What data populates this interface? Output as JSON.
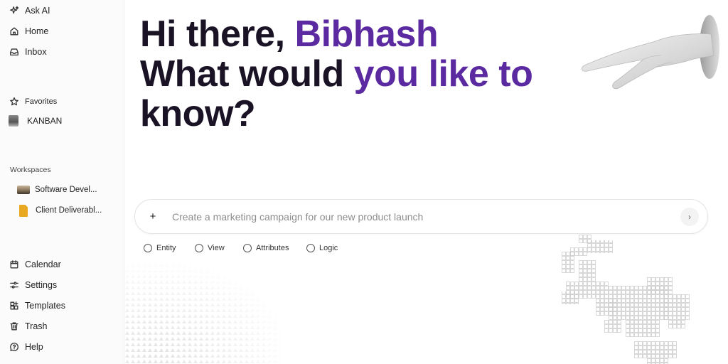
{
  "sidebar": {
    "top_items": [
      {
        "label": "Ask AI",
        "icon": "sparkle-icon"
      },
      {
        "label": "Home",
        "icon": "home-icon"
      },
      {
        "label": "Inbox",
        "icon": "inbox-icon"
      }
    ],
    "favorites": {
      "label": "Favorites",
      "items": [
        {
          "label": "KANBAN",
          "icon": "avatar-icon"
        }
      ]
    },
    "workspaces": {
      "label": "Workspaces",
      "items": [
        {
          "label": "Software Devel..."
        },
        {
          "label": "Client Deliverabl..."
        }
      ]
    },
    "bottom_items": [
      {
        "label": "Calendar",
        "icon": "calendar-icon"
      },
      {
        "label": "Settings",
        "icon": "settings-icon"
      },
      {
        "label": "Templates",
        "icon": "templates-icon"
      },
      {
        "label": "Trash",
        "icon": "trash-icon"
      },
      {
        "label": "Help",
        "icon": "help-icon"
      }
    ]
  },
  "main": {
    "greeting_prefix": "Hi there,",
    "user_name": "Bibhash",
    "question_prefix": "What would",
    "question_accent": "you like to",
    "question_suffix": "know?",
    "prompt": {
      "plus_label": "+",
      "placeholder": "Create a marketing campaign for our new product launch",
      "send_label": "›"
    },
    "options": [
      {
        "label": "Entity"
      },
      {
        "label": "View"
      },
      {
        "label": "Attributes"
      },
      {
        "label": "Logic"
      }
    ]
  },
  "colors": {
    "accent": "#5b2aa0",
    "headline": "#1a1326"
  }
}
